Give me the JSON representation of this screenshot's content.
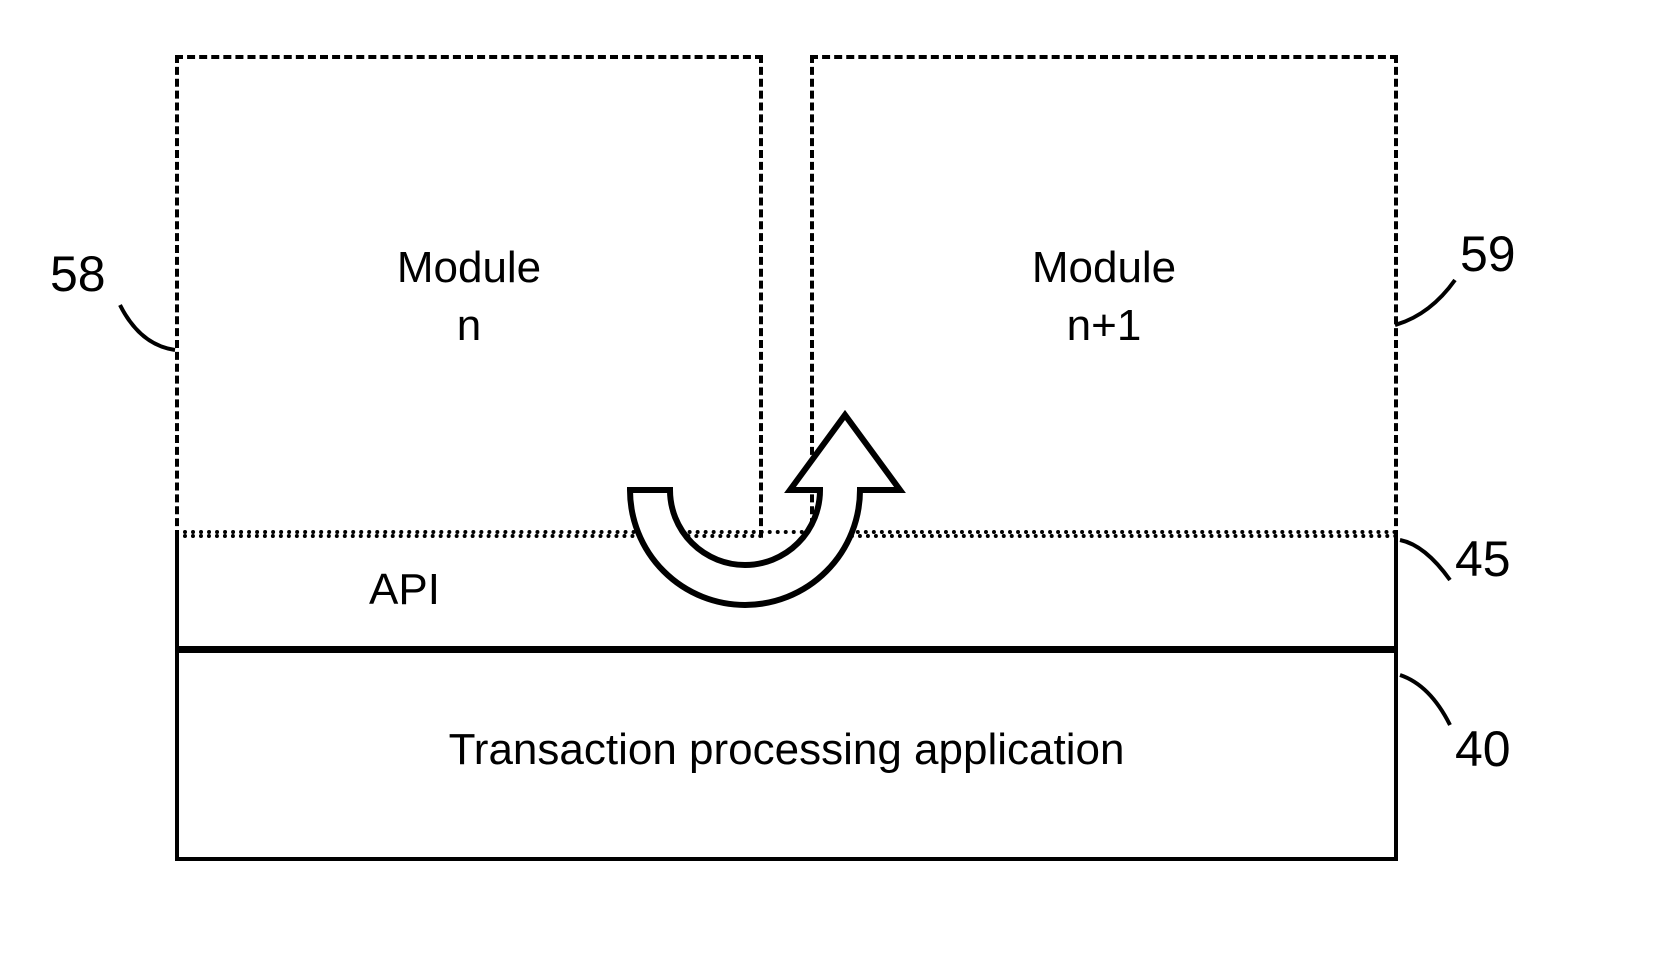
{
  "modules": {
    "left": {
      "title": "Module",
      "sub": "n",
      "ref": "58"
    },
    "right": {
      "title": "Module",
      "sub": "n+1",
      "ref": "59"
    }
  },
  "api": {
    "label": "API",
    "ref": "45"
  },
  "tpa": {
    "label": "Transaction processing application",
    "ref": "40"
  }
}
